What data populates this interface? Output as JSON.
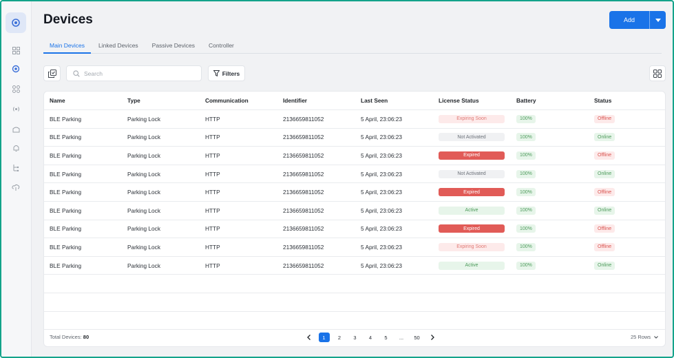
{
  "page": {
    "title": "Devices"
  },
  "header": {
    "add_label": "Add"
  },
  "tabs": [
    {
      "label": "Main Devices",
      "active": true
    },
    {
      "label": "Linked Devices",
      "active": false
    },
    {
      "label": "Passive Devices",
      "active": false
    },
    {
      "label": "Controller",
      "active": false
    }
  ],
  "toolbar": {
    "search_placeholder": "Search",
    "filters_label": "Filters"
  },
  "table": {
    "columns": [
      "Name",
      "Type",
      "Communication",
      "Identifier",
      "Last Seen",
      "License Status",
      "Battery",
      "Status"
    ],
    "rows": [
      {
        "name": "BLE Parking",
        "type": "Parking Lock",
        "communication": "HTTP",
        "identifier": "2136659811052",
        "last_seen": "5 April, 23:06:23",
        "license": "Expiring Soon",
        "battery": "100%",
        "status": "Offline"
      },
      {
        "name": "BLE Parking",
        "type": "Parking Lock",
        "communication": "HTTP",
        "identifier": "2136659811052",
        "last_seen": "5 April, 23:06:23",
        "license": "Not Activated",
        "battery": "100%",
        "status": "Online"
      },
      {
        "name": "BLE Parking",
        "type": "Parking Lock",
        "communication": "HTTP",
        "identifier": "2136659811052",
        "last_seen": "5 April, 23:06:23",
        "license": "Expired",
        "battery": "100%",
        "status": "Offline"
      },
      {
        "name": "BLE Parking",
        "type": "Parking Lock",
        "communication": "HTTP",
        "identifier": "2136659811052",
        "last_seen": "5 April, 23:06:23",
        "license": "Not Activated",
        "battery": "100%",
        "status": "Online"
      },
      {
        "name": "BLE Parking",
        "type": "Parking Lock",
        "communication": "HTTP",
        "identifier": "2136659811052",
        "last_seen": "5 April, 23:06:23",
        "license": "Expired",
        "battery": "100%",
        "status": "Offline"
      },
      {
        "name": "BLE Parking",
        "type": "Parking Lock",
        "communication": "HTTP",
        "identifier": "2136659811052",
        "last_seen": "5 April, 23:06:23",
        "license": "Active",
        "battery": "100%",
        "status": "Online"
      },
      {
        "name": "BLE Parking",
        "type": "Parking Lock",
        "communication": "HTTP",
        "identifier": "2136659811052",
        "last_seen": "5 April, 23:06:23",
        "license": "Expired",
        "battery": "100%",
        "status": "Offline"
      },
      {
        "name": "BLE Parking",
        "type": "Parking Lock",
        "communication": "HTTP",
        "identifier": "2136659811052",
        "last_seen": "5 April, 23:06:23",
        "license": "Expiring Soon",
        "battery": "100%",
        "status": "Offline"
      },
      {
        "name": "BLE Parking",
        "type": "Parking Lock",
        "communication": "HTTP",
        "identifier": "2136659811052",
        "last_seen": "5 April, 23:06:23",
        "license": "Active",
        "battery": "100%",
        "status": "Online"
      }
    ]
  },
  "footer": {
    "total_label": "Total Devices:",
    "total_value": "80",
    "pages": [
      "1",
      "2",
      "3",
      "4",
      "5",
      "...",
      "50"
    ],
    "current_page": "1",
    "rows_label": "25 Rows"
  },
  "colors": {
    "accent": "#1a73e8",
    "expired": "#e15b57",
    "online": "#4c9a5a",
    "offline": "#d9534f",
    "frame": "#13a38a"
  }
}
